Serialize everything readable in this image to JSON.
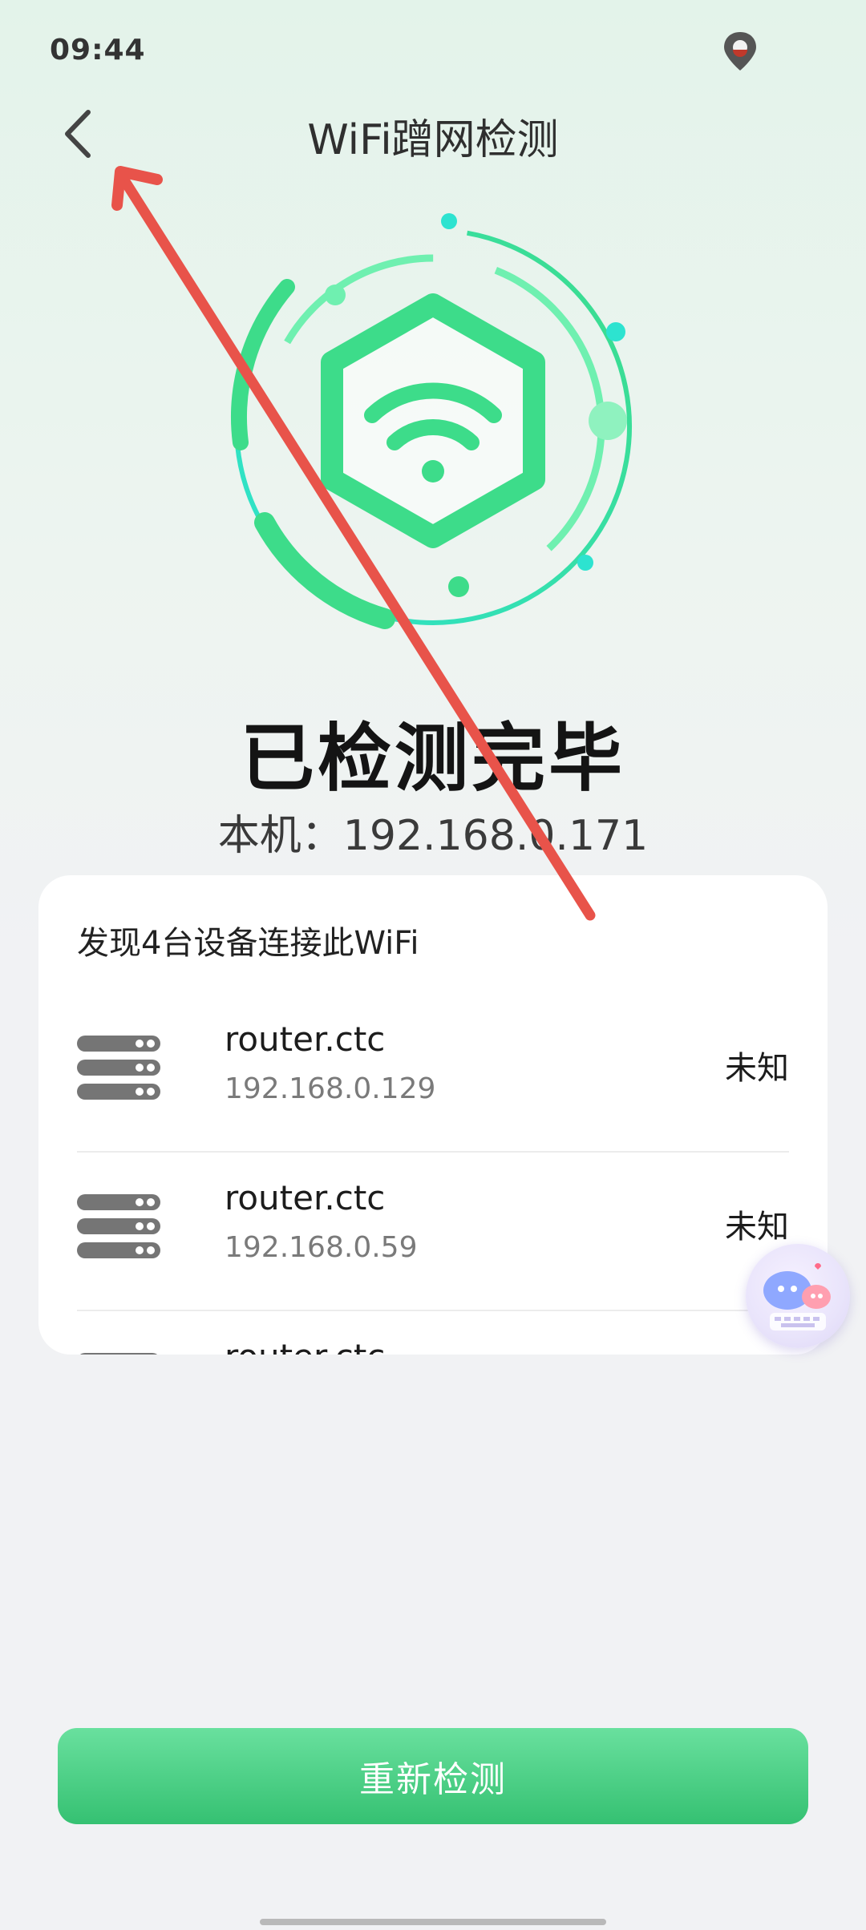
{
  "status_bar": {
    "time": "09:44",
    "location_icon": "location-pin-icon"
  },
  "nav": {
    "back_icon": "chevron-left-icon",
    "title": "WiFi蹭网检测"
  },
  "hero": {
    "icon": "wifi-hexagon-icon",
    "colors": {
      "primary": "#3ddc8a",
      "secondary": "#2de3d0"
    }
  },
  "status": {
    "title": "已检测完毕",
    "local_ip": "本机：192.168.0.171"
  },
  "device_list": {
    "header": "发现4台设备连接此WiFi",
    "devices": [
      {
        "icon": "server-icon",
        "name": "router.ctc",
        "ip": "192.168.0.129",
        "status": "未知"
      },
      {
        "icon": "server-icon",
        "name": "router.ctc",
        "ip": "192.168.0.59",
        "status": "未知"
      },
      {
        "icon": "server-icon",
        "name": "router.ctc",
        "ip": "",
        "status": ""
      }
    ]
  },
  "floating_assistant": {
    "icon": "chat-assistant-icon"
  },
  "actions": {
    "rescan_label": "重新检测",
    "accent": "#35c172"
  },
  "annotation": {
    "arrow_color": "#e8534a"
  }
}
